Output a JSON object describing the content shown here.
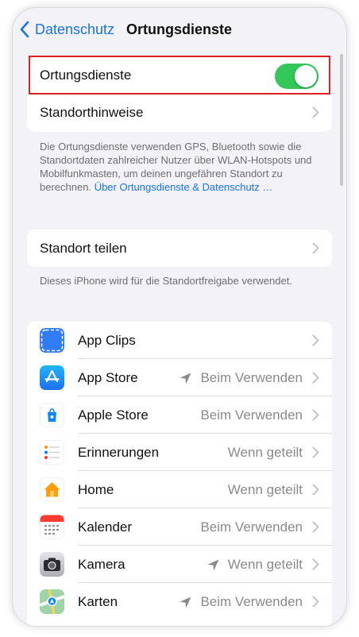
{
  "nav": {
    "back_label": "Datenschutz",
    "title": "Ortungsdienste"
  },
  "location_services": {
    "label": "Ortungsdienste",
    "toggle_on": true,
    "toggle_color": "#34c759",
    "hints_label": "Standorthinweise",
    "description": "Die Ortungsdienste verwenden GPS, Bluetooth sowie die Standortdaten zahlreicher Nutzer über WLAN-Hotspots und Mobilfunkmasten, um deinen ungefähren Standort zu berechnen.",
    "link_text": "Über Ortungsdienste & Datenschutz …"
  },
  "share": {
    "label": "Standort teilen",
    "description": "Dieses iPhone wird für die Standortfreigabe verwendet."
  },
  "apps": [
    {
      "name": "App Clips",
      "value": "",
      "arrow": false,
      "icon": "app-clips-icon"
    },
    {
      "name": "App Store",
      "value": "Beim Verwenden",
      "arrow": true,
      "arrow_style": "outline",
      "icon": "app-store-icon"
    },
    {
      "name": "Apple Store",
      "value": "Beim Verwenden",
      "arrow": false,
      "icon": "apple-store-icon"
    },
    {
      "name": "Erinnerungen",
      "value": "Wenn geteilt",
      "arrow": false,
      "icon": "reminders-icon"
    },
    {
      "name": "Home",
      "value": "Wenn geteilt",
      "arrow": false,
      "icon": "home-icon"
    },
    {
      "name": "Kalender",
      "value": "Beim Verwenden",
      "arrow": false,
      "icon": "calendar-icon"
    },
    {
      "name": "Kamera",
      "value": "Wenn geteilt",
      "arrow": true,
      "arrow_style": "filled",
      "icon": "camera-icon"
    },
    {
      "name": "Karten",
      "value": "Beim Verwenden",
      "arrow": true,
      "arrow_style": "filled",
      "icon": "maps-icon"
    }
  ],
  "colors": {
    "accent": "#1a73e8",
    "highlight_border": "#e02020",
    "background": "#f2f2f7"
  }
}
